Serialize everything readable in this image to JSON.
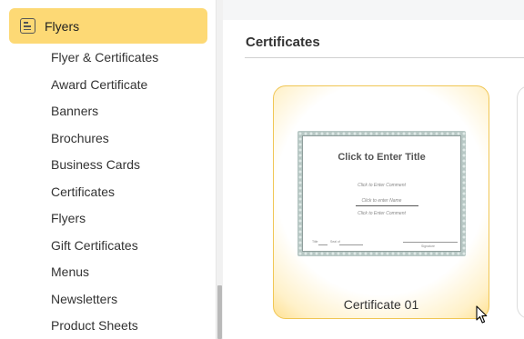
{
  "sidebar": {
    "category": "Flyers",
    "items": [
      {
        "label": "Flyer & Certificates"
      },
      {
        "label": "Award Certificate"
      },
      {
        "label": "Banners"
      },
      {
        "label": "Brochures"
      },
      {
        "label": "Business Cards"
      },
      {
        "label": "Certificates"
      },
      {
        "label": "Flyers"
      },
      {
        "label": "Gift Certificates"
      },
      {
        "label": "Menus"
      },
      {
        "label": "Newsletters"
      },
      {
        "label": "Product Sheets"
      }
    ]
  },
  "main": {
    "section_title": "Certificates",
    "templates": [
      {
        "label": "Certificate 01",
        "preview": {
          "title": "Click to Enter Title",
          "comment_top": "Click to Enter Comment",
          "name": "Click to enter Name",
          "comment_bottom": "Click to Enter Comment",
          "foot_left_1": "Title",
          "foot_left_2": "Seal of",
          "foot_right": "Signature"
        }
      }
    ]
  },
  "colors": {
    "selected_category_bg": "#fdd975",
    "card_border": "#f0c654",
    "certificate_border": "#b7c7c4"
  },
  "icons": {
    "category": "document-icon",
    "pointer": "mouse-cursor-icon"
  }
}
